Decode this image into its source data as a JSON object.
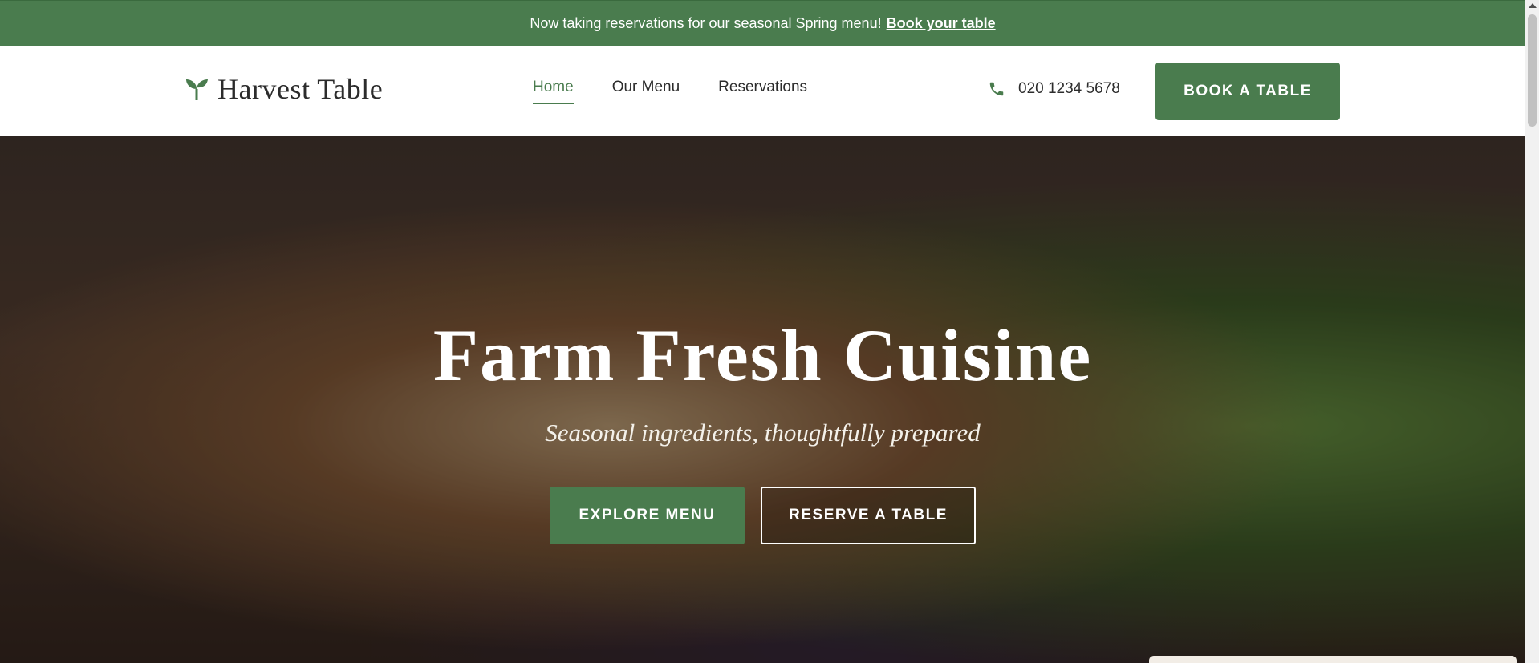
{
  "announcement": {
    "text": "Now taking reservations for our seasonal Spring menu!",
    "link": "Book your table"
  },
  "header": {
    "logo_text": "Harvest Table",
    "logo_icon": "sprout-icon",
    "nav": [
      {
        "label": "Home",
        "active": true
      },
      {
        "label": "Our Menu",
        "active": false
      },
      {
        "label": "Reservations",
        "active": false
      }
    ],
    "phone": "020 1234 5678",
    "book_button": "BOOK A TABLE"
  },
  "hero": {
    "title": "Farm Fresh Cuisine",
    "subtitle": "Seasonal ingredients, thoughtfully prepared",
    "primary_button": "EXPLORE MENU",
    "secondary_button": "RESERVE A TABLE"
  },
  "colors": {
    "brand_green": "#4a7c4e",
    "text_dark": "#2c2c2c",
    "white": "#ffffff"
  }
}
